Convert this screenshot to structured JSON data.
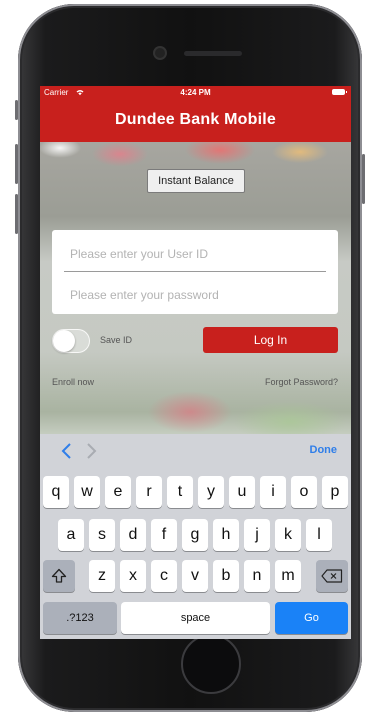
{
  "status_bar": {
    "carrier": "Carrier",
    "time": "4:24 PM"
  },
  "nav": {
    "title": "Dundee Bank Mobile"
  },
  "instant_balance_label": "Instant Balance",
  "login": {
    "user_placeholder": "Please enter your User ID",
    "password_placeholder": "Please enter your password",
    "save_id_label": "Save ID",
    "save_id_on": false,
    "login_label": "Log In",
    "enroll_label": "Enroll now",
    "forgot_label": "Forgot Password?"
  },
  "keyboard": {
    "done_label": "Done",
    "row1": [
      "q",
      "w",
      "e",
      "r",
      "t",
      "y",
      "u",
      "i",
      "o",
      "p"
    ],
    "row2": [
      "a",
      "s",
      "d",
      "f",
      "g",
      "h",
      "j",
      "k",
      "l"
    ],
    "row3": [
      "z",
      "x",
      "c",
      "v",
      "b",
      "n",
      "m"
    ],
    "numbers_label": ".?123",
    "space_label": "space",
    "go_label": "Go"
  },
  "colors": {
    "brand_red": "#c8201d",
    "accent_blue": "#1a82f7"
  },
  "icons": [
    "wifi-icon",
    "battery-icon",
    "chevron-left-icon",
    "chevron-right-icon",
    "shift-icon",
    "backspace-icon"
  ]
}
